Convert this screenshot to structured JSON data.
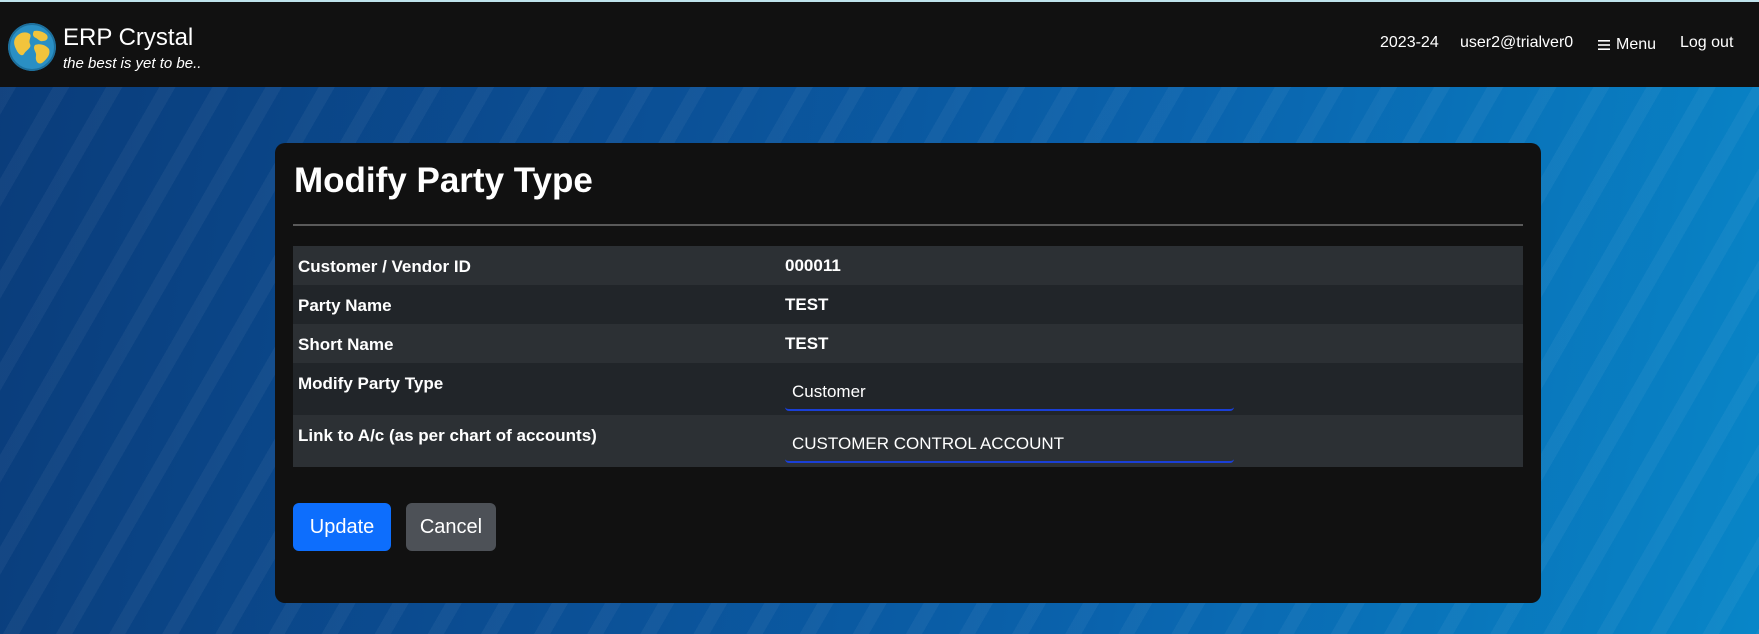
{
  "app": {
    "title": "ERP Crystal",
    "tagline": "the best is yet to be.."
  },
  "nav": {
    "year": "2023-24",
    "user": "user2@trialver0",
    "menu_icon": "hamburger-icon",
    "menu_label": "Menu",
    "logout_label": "Log out"
  },
  "page": {
    "title": "Modify Party Type"
  },
  "details": [
    {
      "label": "Customer / Vendor ID",
      "value": "000011"
    },
    {
      "label": "Party Name",
      "value": "TEST"
    },
    {
      "label": "Short Name",
      "value": "TEST"
    }
  ],
  "form": {
    "party_type": {
      "label": "Modify Party Type",
      "value": "Customer"
    },
    "link_account": {
      "label": "Link to A/c (as per chart of accounts)",
      "value": "CUSTOMER CONTROL ACCOUNT"
    }
  },
  "actions": {
    "update_label": "Update",
    "cancel_label": "Cancel"
  },
  "colors": {
    "primary": "#0d6efd",
    "secondary": "#4d5157",
    "field_underline": "#1a3fd6",
    "navbar": "#111111"
  }
}
